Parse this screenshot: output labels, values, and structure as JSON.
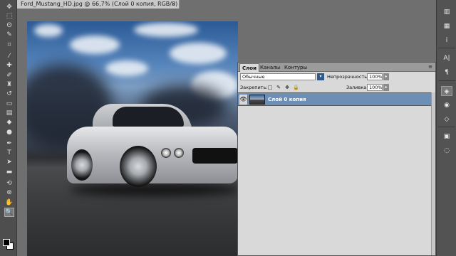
{
  "document": {
    "tab_title": "Ford_Mustang_HD.jpg @ 66,7% (Слой 0 копия, RGB/8) *",
    "close_glyph": "×"
  },
  "toolbar": {
    "tools": [
      {
        "icon": "move-icon",
        "glyph": "✥"
      },
      {
        "icon": "marquee-icon",
        "glyph": "⬚"
      },
      {
        "icon": "lasso-icon",
        "glyph": "ʘ"
      },
      {
        "icon": "quick-select-icon",
        "glyph": "✎"
      },
      {
        "icon": "crop-icon",
        "glyph": "⌗"
      },
      {
        "icon": "eyedropper-icon",
        "glyph": "⁄"
      },
      {
        "icon": "healing-brush-icon",
        "glyph": "✚"
      },
      {
        "icon": "brush-icon",
        "glyph": "✐"
      },
      {
        "icon": "clone-stamp-icon",
        "glyph": "♜"
      },
      {
        "icon": "history-brush-icon",
        "glyph": "↺"
      },
      {
        "icon": "eraser-icon",
        "glyph": "▭"
      },
      {
        "icon": "gradient-icon",
        "glyph": "▤"
      },
      {
        "icon": "blur-icon",
        "glyph": "◆"
      },
      {
        "icon": "dodge-icon",
        "glyph": "●"
      },
      {
        "icon": "pen-icon",
        "glyph": "✒"
      },
      {
        "icon": "type-icon",
        "glyph": "T"
      },
      {
        "icon": "path-select-icon",
        "glyph": "➤"
      },
      {
        "icon": "shape-icon",
        "glyph": "▬"
      },
      {
        "icon": "3d-rotate-icon",
        "glyph": "⟲"
      },
      {
        "icon": "3d-camera-icon",
        "glyph": "⊛"
      },
      {
        "icon": "hand-icon",
        "glyph": "✋"
      },
      {
        "icon": "zoom-icon",
        "glyph": "🔍"
      }
    ]
  },
  "right_strip": {
    "buttons": [
      {
        "icon": "color-panel-icon",
        "glyph": "▥"
      },
      {
        "icon": "swatches-icon",
        "glyph": "▦"
      },
      {
        "icon": "info-icon",
        "glyph": "i"
      },
      {
        "icon": "character-icon",
        "glyph": "A|"
      },
      {
        "icon": "paragraph-icon",
        "glyph": "¶"
      },
      {
        "icon": "layers-panel-icon",
        "glyph": "◈"
      },
      {
        "icon": "channels-icon",
        "glyph": "◉"
      },
      {
        "icon": "paths-icon",
        "glyph": "◇"
      },
      {
        "icon": "adjustments-icon",
        "glyph": "▣"
      },
      {
        "icon": "masks-icon",
        "glyph": "◌"
      }
    ]
  },
  "layers_panel": {
    "tabs": [
      "Слои",
      "Каналы",
      "Контуры"
    ],
    "menu_glyph": "≡",
    "blend_mode": "Обычные",
    "opacity_label": "Непрозрачность:",
    "opacity_value": "100%",
    "lock_label": "Закрепить:",
    "fill_label": "Заливка:",
    "fill_value": "100%",
    "lock_icons": [
      "□",
      "✎",
      "✥",
      "🔒"
    ],
    "layers": [
      {
        "name": "Слой 0 копия",
        "visible_glyph": "👁"
      }
    ]
  }
}
